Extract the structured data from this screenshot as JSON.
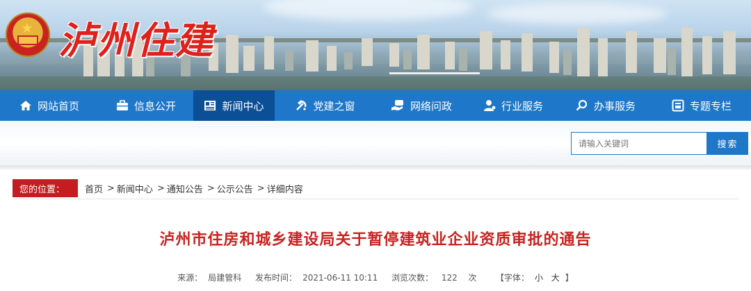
{
  "site": {
    "logo_text": "泸州住建"
  },
  "nav": {
    "items": [
      {
        "label": "网站首页",
        "icon": "home-icon"
      },
      {
        "label": "信息公开",
        "icon": "briefcase-icon"
      },
      {
        "label": "新闻中心",
        "icon": "newspaper-icon",
        "active": true
      },
      {
        "label": "党建之窗",
        "icon": "party-emblem-icon"
      },
      {
        "label": "网络问政",
        "icon": "chat-hand-icon"
      },
      {
        "label": "行业服务",
        "icon": "user-service-icon"
      },
      {
        "label": "办事服务",
        "icon": "search-icon"
      },
      {
        "label": "专题专栏",
        "icon": "column-icon"
      }
    ],
    "active_color": "#0b4f96",
    "bar_color": "#1e77c8"
  },
  "search": {
    "placeholder": "请输入关键词",
    "button_label": "搜索"
  },
  "breadcrumb": {
    "label": "您的位置：",
    "items": [
      "首页",
      "新闻中心",
      "通知公告",
      "公示公告",
      "详细内容"
    ],
    "separator": ">"
  },
  "article": {
    "title": "泸州市住房和城乡建设局关于暂停建筑业企业资质审批的通告",
    "source_label": "来源：",
    "source": "局建管科",
    "time_label": "发布时间：",
    "time": "2021-06-11 10:11",
    "views_label": "浏览次数：",
    "views": "122",
    "views_unit": "次",
    "font_label": "【字体：",
    "font_small": "小",
    "font_large": "大",
    "font_close": "】"
  }
}
